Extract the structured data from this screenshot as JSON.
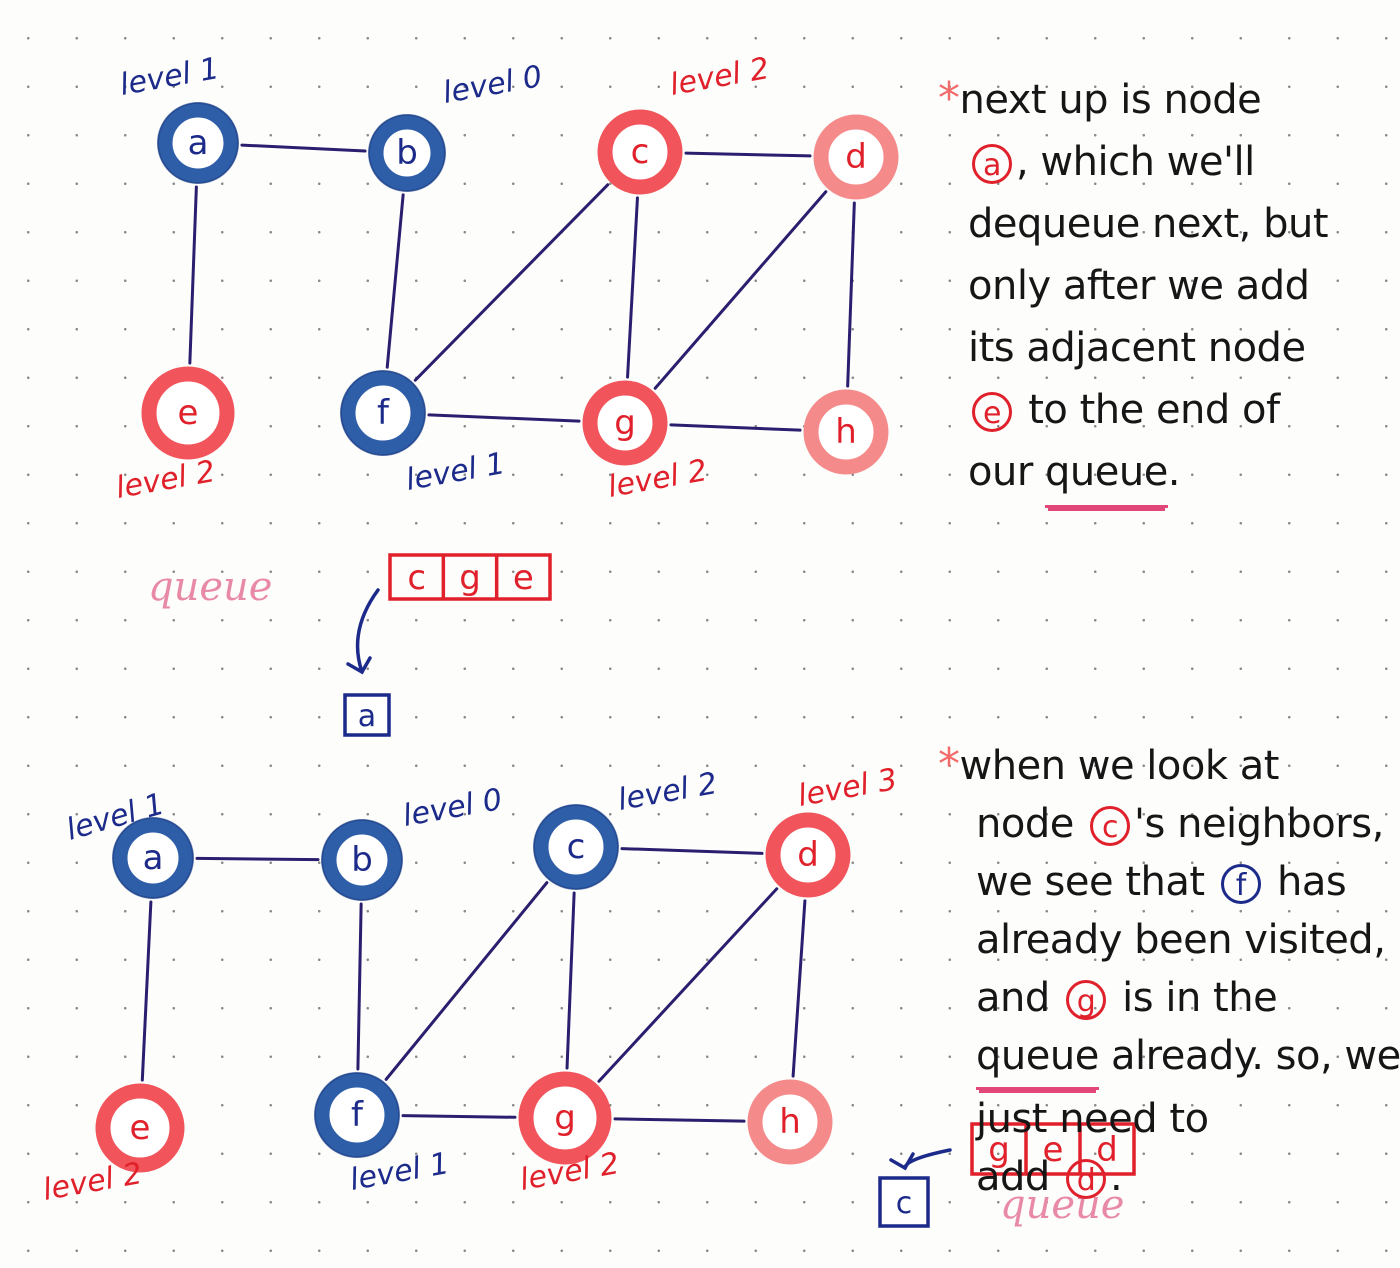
{
  "colors": {
    "visited_blue": "#2f5ea8",
    "visited_blue_dark": "#1f3f86",
    "queued_red": "#f2545b",
    "pending_pink": "#f48a8a",
    "edge": "#2a1f6e",
    "label_blue": "#1c2a8a",
    "label_red": "#e0202a",
    "queue_word_pink": "#e88aa6",
    "ink": "#161616"
  },
  "panels": [
    {
      "id": "step-1",
      "nodes": [
        {
          "id": "a",
          "label": "a",
          "level_label": "level 1",
          "state": "visited"
        },
        {
          "id": "b",
          "label": "b",
          "level_label": "level 0",
          "state": "visited"
        },
        {
          "id": "c",
          "label": "c",
          "level_label": "level 2",
          "state": "queued"
        },
        {
          "id": "d",
          "label": "d",
          "level_label": "",
          "state": "pending"
        },
        {
          "id": "e",
          "label": "e",
          "level_label": "level 2",
          "state": "queued"
        },
        {
          "id": "f",
          "label": "f",
          "level_label": "level 1",
          "state": "visited"
        },
        {
          "id": "g",
          "label": "g",
          "level_label": "level 2",
          "state": "queued"
        },
        {
          "id": "h",
          "label": "h",
          "level_label": "",
          "state": "pending"
        }
      ],
      "edges": [
        [
          "a",
          "b"
        ],
        [
          "a",
          "e"
        ],
        [
          "b",
          "f"
        ],
        [
          "c",
          "d"
        ],
        [
          "c",
          "f"
        ],
        [
          "c",
          "g"
        ],
        [
          "d",
          "g"
        ],
        [
          "d",
          "h"
        ],
        [
          "f",
          "g"
        ],
        [
          "g",
          "h"
        ]
      ],
      "queue_label": "queue",
      "queue": [
        "c",
        "g",
        "e"
      ],
      "dequeued": "a",
      "note": {
        "star": "*",
        "lines": [
          [
            "next up is node"
          ],
          [
            "@a",
            ", which we'll"
          ],
          [
            "dequeue next, but"
          ],
          [
            "only after we add"
          ],
          [
            "its adjacent node"
          ],
          [
            "@e",
            " to the end of"
          ],
          [
            "our ",
            "_queue",
            "."
          ]
        ]
      }
    },
    {
      "id": "step-2",
      "nodes": [
        {
          "id": "a",
          "label": "a",
          "level_label": "level 1",
          "state": "visited"
        },
        {
          "id": "b",
          "label": "b",
          "level_label": "level 0",
          "state": "visited"
        },
        {
          "id": "c",
          "label": "c",
          "level_label": "level 2",
          "state": "visited"
        },
        {
          "id": "d",
          "label": "d",
          "level_label": "level 3",
          "state": "queued"
        },
        {
          "id": "e",
          "label": "e",
          "level_label": "level 2",
          "state": "queued"
        },
        {
          "id": "f",
          "label": "f",
          "level_label": "level 1",
          "state": "visited"
        },
        {
          "id": "g",
          "label": "g",
          "level_label": "level 2",
          "state": "queued"
        },
        {
          "id": "h",
          "label": "h",
          "level_label": "",
          "state": "pending"
        }
      ],
      "edges": [
        [
          "a",
          "b"
        ],
        [
          "a",
          "e"
        ],
        [
          "b",
          "f"
        ],
        [
          "c",
          "d"
        ],
        [
          "c",
          "f"
        ],
        [
          "c",
          "g"
        ],
        [
          "d",
          "g"
        ],
        [
          "d",
          "h"
        ],
        [
          "f",
          "g"
        ],
        [
          "g",
          "h"
        ]
      ],
      "queue_label": "queue",
      "queue": [
        "g",
        "e",
        "d"
      ],
      "dequeued": "c",
      "note": {
        "star": "*",
        "lines": [
          [
            "when we look at"
          ],
          [
            "node ",
            "@c",
            "'s neighbors,"
          ],
          [
            "we see that ",
            "#f",
            " has"
          ],
          [
            "already been visited,"
          ],
          [
            "and ",
            "@g",
            " is in the"
          ],
          [
            "_queue",
            " already. so, we"
          ],
          [
            "just need to"
          ],
          [
            "add ",
            "@d",
            "."
          ]
        ]
      }
    }
  ]
}
